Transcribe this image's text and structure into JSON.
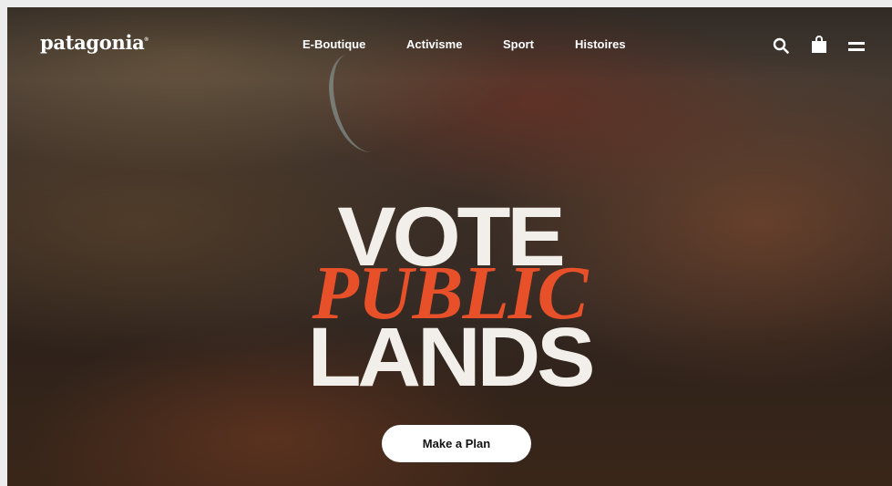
{
  "brand": {
    "logo_text": "patagonia",
    "logo_mark": "®"
  },
  "nav": {
    "items": [
      {
        "label": "E-Boutique"
      },
      {
        "label": "Activisme"
      },
      {
        "label": "Sport"
      },
      {
        "label": "Histoires"
      }
    ]
  },
  "header_icons": [
    "search-icon",
    "shopping-bag-icon",
    "menu-icon"
  ],
  "hero": {
    "line1": "VOTE",
    "line2": "PUBLIC",
    "line3": "LANDS",
    "cta_label": "Make a Plan"
  },
  "colors": {
    "accent": "#e8502a",
    "headline_light": "#f2efea",
    "button_bg": "#ffffff",
    "nav_text": "#ffffff"
  }
}
